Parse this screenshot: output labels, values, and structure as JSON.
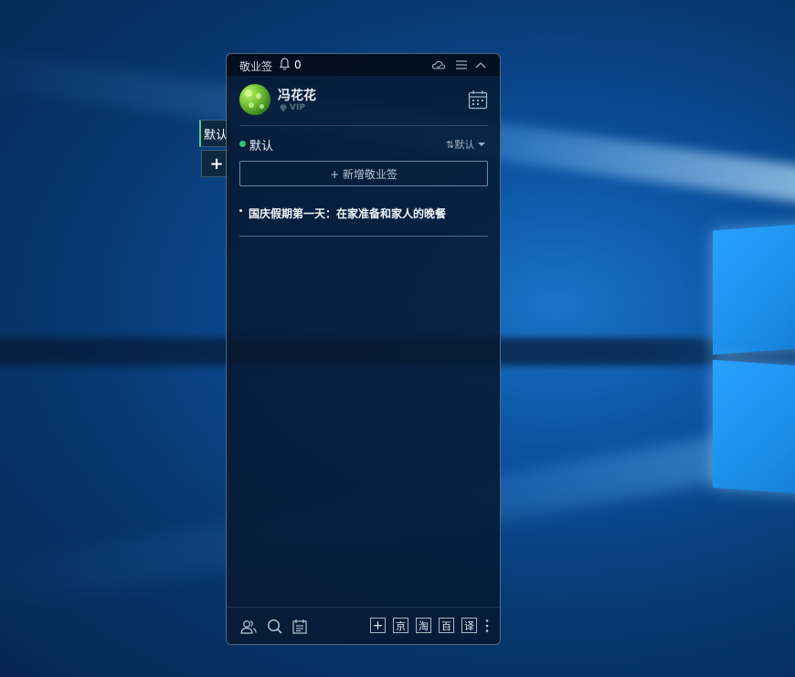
{
  "side_tabs": {
    "default_label": "默认",
    "add_label": "+"
  },
  "titlebar": {
    "app_title": "敬业签",
    "notification_count": "0"
  },
  "user": {
    "name": "冯花花",
    "badge": "VIP"
  },
  "group": {
    "name": "默认",
    "sort_label": "⇅默认"
  },
  "add_note_label": "+ 新增敬业签",
  "notes": [
    {
      "text": "国庆假期第一天：在家准备和家人的晚餐"
    }
  ],
  "shortcuts": {
    "add": "+",
    "jd": "京",
    "taobao": "淘",
    "baidu": "百",
    "translate": "译"
  },
  "colors": {
    "accent_green": "#32c26a",
    "panel_bg": "#06192f",
    "border": "#4d6b86"
  }
}
